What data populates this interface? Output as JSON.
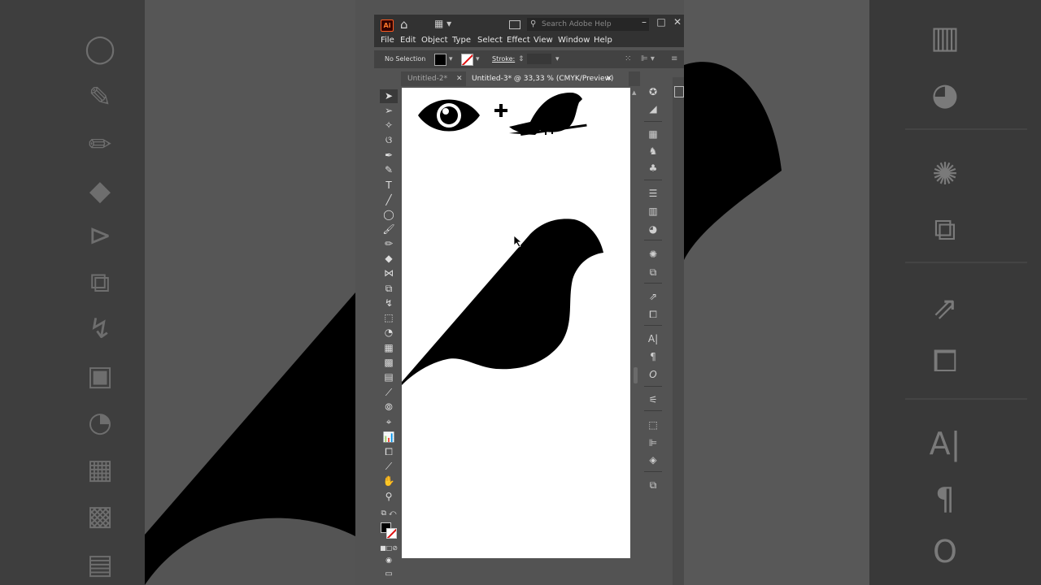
{
  "app": {
    "logo_text": "Ai",
    "search_placeholder": "Search Adobe Help"
  },
  "menu": [
    "File",
    "Edit",
    "Object",
    "Type",
    "Select",
    "Effect",
    "View",
    "Window",
    "Help"
  ],
  "control_bar": {
    "selection_label": "No Selection",
    "stroke_label": "Stroke:"
  },
  "tabs": [
    {
      "label": "Untitled-2* ..."
    },
    {
      "label": "Untitled-3* @ 33,33 % (CMYK/Preview)"
    }
  ],
  "icons": {
    "home": "home-icon",
    "plus": "plus-icon"
  },
  "colors": {
    "app_chrome": "#323232",
    "panel": "#535353",
    "artboard": "#ffffff",
    "shape": "#000000"
  }
}
